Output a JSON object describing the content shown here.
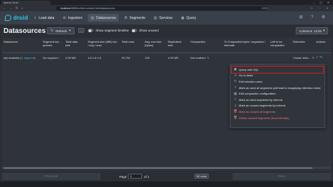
{
  "browser": {
    "tab_title": "Apache Druid",
    "url_host": "localhost",
    "url_path": ":8888/unified-console.html#datasources",
    "zoom": "133%"
  },
  "nav": {
    "logo": "druid",
    "items": [
      {
        "label": "Load data",
        "icon": "cloud-upload-icon"
      },
      {
        "label": "Ingestion",
        "icon": "gear-icon"
      },
      {
        "label": "Datasources",
        "icon": "database-icon",
        "active": true
      },
      {
        "label": "Segments",
        "icon": "stack-icon"
      },
      {
        "label": "Services",
        "icon": "server-icon"
      },
      {
        "label": "Query",
        "icon": "console-icon"
      }
    ]
  },
  "page": {
    "title": "Datasources",
    "refresh_label": "Refresh",
    "more_label": "...",
    "show_timeline_label": "Show segment timeline",
    "show_unused_label": "Show unused",
    "columns_label": "Columns: 11/15"
  },
  "table": {
    "headers": [
      "Datasource",
      "Segment loa... queues",
      "Total data size",
      "Segment size (MB) min / avg / max",
      "Total rows",
      "Avg. row size (bytes)",
      "Replicated size",
      "Compaction",
      "% Compacted bytes / segments / intervals",
      "Left to be compacted",
      "Retention",
      "Actions"
    ],
    "row": {
      "datasource_partial": "ally available (",
      "datasource_link": "1 segment",
      "datasource_tail": ")",
      "load_queue": "No segment...",
      "total_size": "4.99 MB",
      "segment_size": "4.6  4.6  4.6",
      "total_rows": "39,754",
      "avg_row_size": "128",
      "replicated_size": "4.99 MB",
      "compaction": "Not enabled",
      "compacted_pct": "",
      "left_to_compact": "",
      "retention": "Cluster defa..."
    }
  },
  "menu": {
    "items": [
      {
        "label": "Query with SQL",
        "icon": "console-icon",
        "highlight": true
      },
      {
        "label": "Go to tasks",
        "icon": "gantt-icon"
      },
      {
        "label": "Edit retention rules",
        "icon": "automatic-updates-icon"
      },
      {
        "label": "Mark as used all segments (will lead to reapplying retention rules)",
        "icon": "export-icon"
      },
      {
        "label": "Edit compaction configuration",
        "icon": "compressed-icon"
      },
      {
        "label": "Mark as used segments by interval",
        "icon": "export-icon"
      },
      {
        "label": "Mark as unused segments by interval",
        "icon": "import-icon"
      },
      {
        "label": "Mark as unused all segments",
        "icon": "trash-icon",
        "danger": true
      },
      {
        "label": "Delete unused segments (issue kill task)",
        "icon": "trash-icon",
        "danger": true
      }
    ]
  },
  "pagination": {
    "previous_label": "Previous",
    "page_label": "Page",
    "page_value": "1",
    "of_label": "of 1",
    "rows_select": "50 rows",
    "next_label": "Next"
  }
}
